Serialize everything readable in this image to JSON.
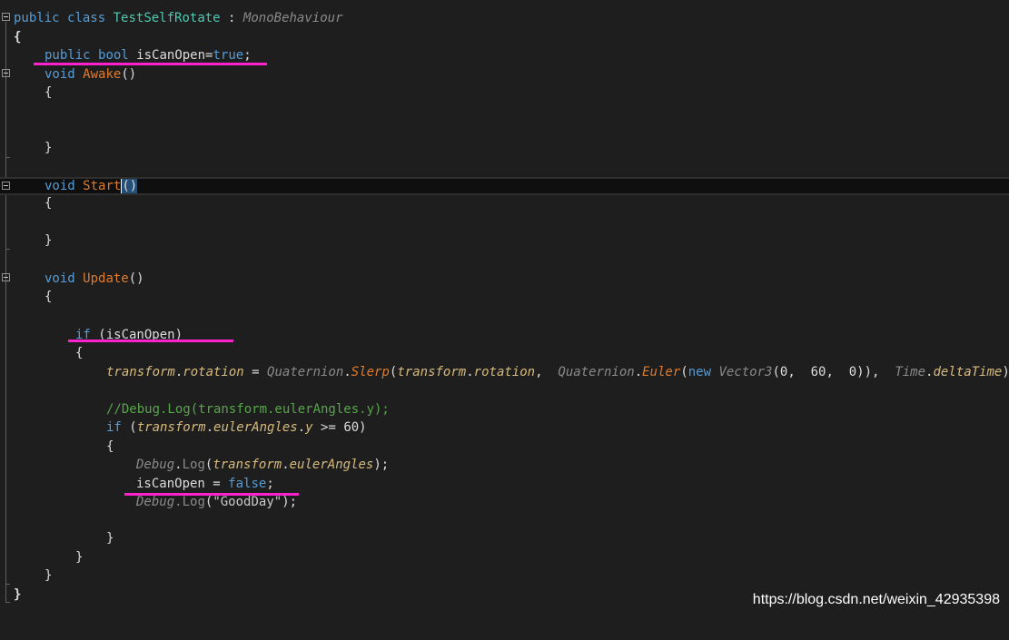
{
  "editor": {
    "lines": {
      "l1": {
        "public": "public",
        "class": "class",
        "name": "TestSelfRotate",
        "colon": " : ",
        "base": "MonoBehaviour"
      },
      "l2": "{",
      "l3": {
        "public": "public",
        "bool": "bool",
        "field": "isCanOpen",
        "eq": "=",
        "val": "true",
        "semi": ";"
      },
      "l4": {
        "void": "void",
        "name": "Awake",
        "parens": "()"
      },
      "l5": "{",
      "l8": "}",
      "l10": {
        "void": "void",
        "name": "Start",
        "parens": "()"
      },
      "l11": "{",
      "l13": "}",
      "l15": {
        "void": "void",
        "name": "Update",
        "parens": "()"
      },
      "l16": "{",
      "l18": {
        "if": "if",
        "cond": " (isCanOpen)"
      },
      "l19": "{",
      "l20": {
        "a": "transform",
        "b": ".",
        "c": "rotation",
        "d": " = ",
        "e": "Quaternion",
        "f": ".",
        "g": "Slerp",
        "h": "(",
        "i": "transform",
        "j": ".",
        "k": "rotation",
        "l": ",  ",
        "m": "Quaternion",
        "n": ".",
        "o": "Euler",
        "p": "(",
        "q": "new",
        "r": " ",
        "s": "Vector3",
        "t": "(0,  60,  0)),  ",
        "u": "Time",
        "v": ".",
        "w": "deltaTime",
        "x": ");"
      },
      "l22": "//Debug.Log(transform.eulerAngles.y);",
      "l23": {
        "if": "if",
        "a": " (",
        "b": "transform",
        "c": ".",
        "d": "eulerAngles",
        "e": ".",
        "f": "y",
        "g": " >= 60)"
      },
      "l24": "{",
      "l25": {
        "a": "Debug",
        "b": ".",
        "c": "Log",
        "d": "(",
        "e": "transform",
        "f": ".",
        "g": "eulerAngles",
        "h": ");"
      },
      "l26": {
        "a": "isCanOpen",
        "b": " = ",
        "c": "false",
        "d": ";"
      },
      "l27": {
        "a": "Debug",
        "b": ".",
        "c": "Log",
        "d": "(",
        "e": "\"GoodDay\"",
        "f": ");"
      },
      "l29": "}",
      "l30": "}",
      "l31": "}",
      "l32": "}"
    }
  },
  "watermark": "https://blog.csdn.net/weixin_42935398",
  "colors": {
    "highlight_marks": "#ff22cc",
    "background": "#1e1e1e"
  }
}
